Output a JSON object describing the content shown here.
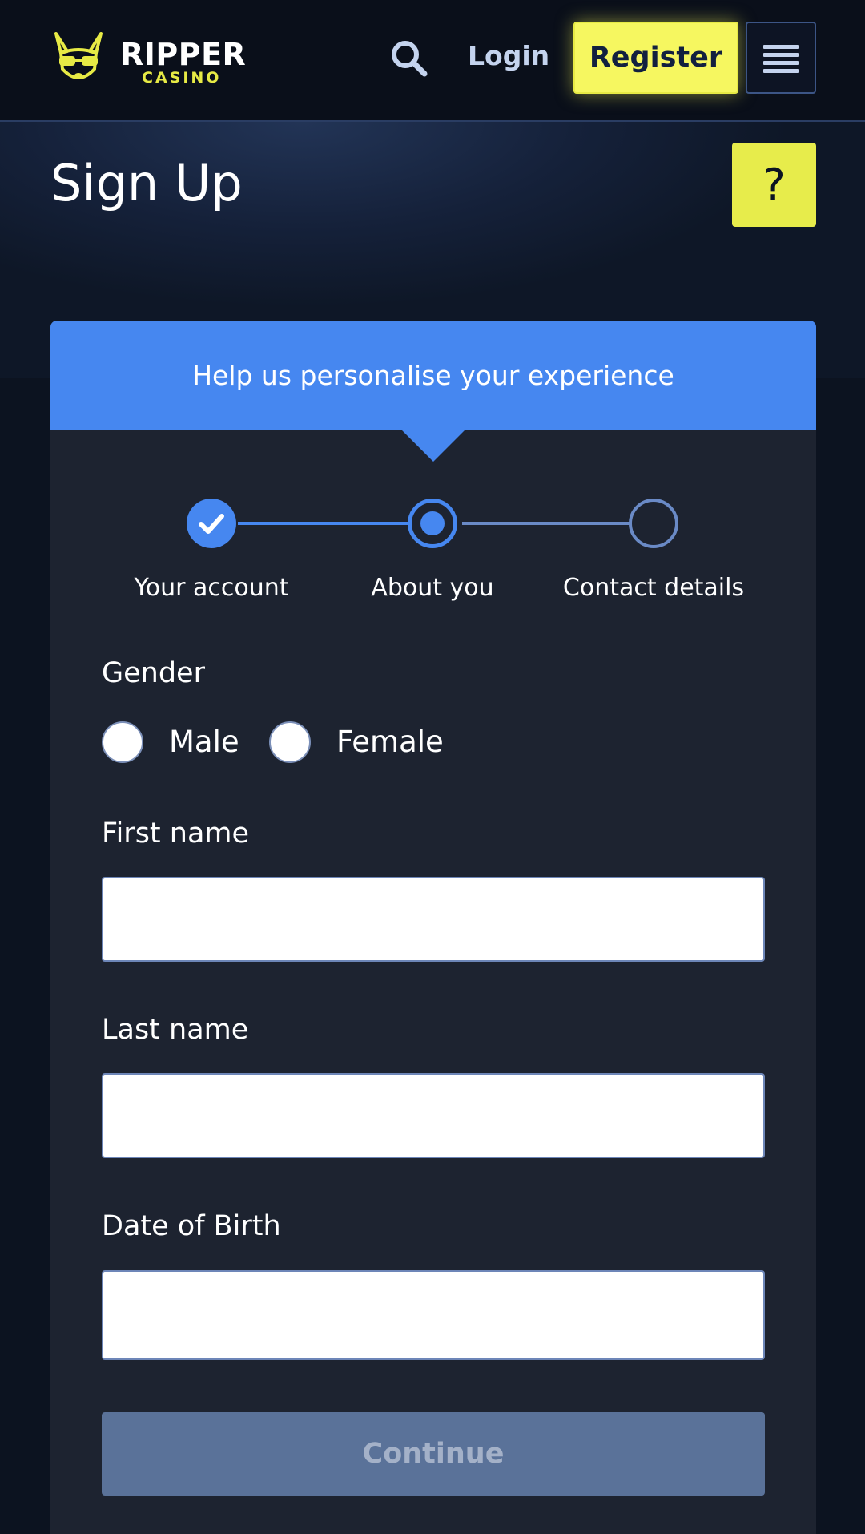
{
  "header": {
    "logo": {
      "word1": "RIPPER",
      "word2": "CASINO",
      "icon": "kangaroo-logo-icon"
    },
    "search_icon": "search-icon",
    "login_label": "Login",
    "register_label": "Register",
    "menu_icon": "hamburger-menu-icon"
  },
  "page": {
    "title": "Sign Up",
    "help_label": "?"
  },
  "form": {
    "banner_text": "Help us personalise your experience",
    "steps": [
      {
        "label": "Your account",
        "state": "completed"
      },
      {
        "label": "About you",
        "state": "active"
      },
      {
        "label": "Contact details",
        "state": "pending"
      }
    ],
    "gender": {
      "label": "Gender",
      "options": [
        "Male",
        "Female"
      ]
    },
    "first_name": {
      "label": "First name",
      "value": ""
    },
    "last_name": {
      "label": "Last name",
      "value": ""
    },
    "dob": {
      "label": "Date of Birth",
      "value": ""
    },
    "continue_label": "Continue"
  },
  "colors": {
    "brand_yellow": "#f6f760",
    "accent_blue": "#4687f0",
    "card_bg": "#1d2330",
    "page_bg": "#0c1320",
    "disabled_button": "#5a7299"
  }
}
